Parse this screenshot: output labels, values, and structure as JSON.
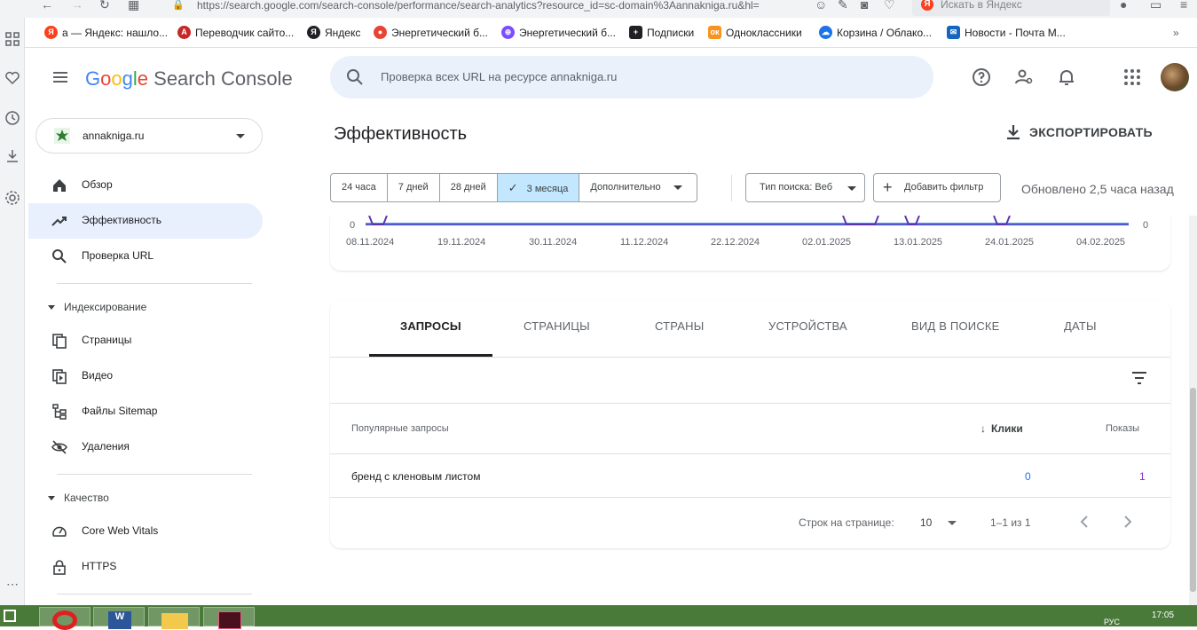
{
  "browser": {
    "url": "https://search.google.com/search-console/performance/search-analytics?resource_id=sc-domain%3Aannakniga.ru&hl=",
    "yandex_search_placeholder": "Искать в Яндекс"
  },
  "bookmarks": [
    {
      "label": "а — Яндекс: нашло...",
      "color": "#fc3f1d"
    },
    {
      "label": "Переводчик сайто...",
      "color": "#c62828"
    },
    {
      "label": "Яндекс",
      "color": "#202124"
    },
    {
      "label": "Энергетический б...",
      "color": "#ea4335"
    },
    {
      "label": "Энергетический б...",
      "color": "#7c4dff"
    },
    {
      "label": "Подписки",
      "color": "#202124"
    },
    {
      "label": "Одноклассники",
      "color": "#f7931e"
    },
    {
      "label": "Корзина / Облако...",
      "color": "#1a73e8"
    },
    {
      "label": "Новости - Почта М...",
      "color": "#1565c0"
    }
  ],
  "header": {
    "logo_google": "Google",
    "logo_product": "Search Console",
    "search_placeholder": "Проверка всех URL на ресурсе annakniga.ru"
  },
  "sidebar": {
    "property": "annakniga.ru",
    "items": [
      {
        "label": "Обзор",
        "icon": "home-icon"
      },
      {
        "label": "Эффективность",
        "icon": "trending-up-icon"
      },
      {
        "label": "Проверка URL",
        "icon": "search-icon"
      }
    ],
    "section_indexing": "Индексирование",
    "indexing_items": [
      {
        "label": "Страницы",
        "icon": "pages-icon"
      },
      {
        "label": "Видео",
        "icon": "video-icon"
      },
      {
        "label": "Файлы Sitemap",
        "icon": "sitemap-icon"
      },
      {
        "label": "Удаления",
        "icon": "removal-icon"
      }
    ],
    "section_quality": "Качество",
    "quality_items": [
      {
        "label": "Core Web Vitals",
        "icon": "gauge-icon"
      },
      {
        "label": "HTTPS",
        "icon": "lock-icon"
      }
    ]
  },
  "main": {
    "title": "Эффективность",
    "export_label": "ЭКСПОРТИРОВАТЬ",
    "ranges": [
      "24 часа",
      "7 дней",
      "28 дней",
      "3 месяца",
      "Дополнительно"
    ],
    "selected_range": "3 месяца",
    "search_type": "Тип поиска: Веб",
    "add_filter": "Добавить фильтр",
    "updated": "Обновлено 2,5 часа назад"
  },
  "chart_data": {
    "type": "line",
    "x_ticks": [
      "08.11.2024",
      "19.11.2024",
      "30.11.2024",
      "11.12.2024",
      "22.12.2024",
      "02.01.2025",
      "13.01.2025",
      "24.01.2025",
      "04.02.2025"
    ],
    "y_left_label": "0",
    "y_right_label": "0",
    "baseline": 0
  },
  "table": {
    "tabs": [
      "ЗАПРОСЫ",
      "СТРАНИЦЫ",
      "СТРАНЫ",
      "УСТРОЙСТВА",
      "ВИД В ПОИСКЕ",
      "ДАТЫ"
    ],
    "columns": {
      "query": "Популярные запросы",
      "clicks": "Клики",
      "impressions": "Показы"
    },
    "rows": [
      {
        "query": "бренд с кленовым листом",
        "clicks": "0",
        "impressions": "1"
      }
    ],
    "rows_per_page_label": "Строк на странице:",
    "rows_per_page": "10",
    "range": "1–1 из 1"
  },
  "taskbar": {
    "lang": "РУС",
    "time": "17:05"
  }
}
